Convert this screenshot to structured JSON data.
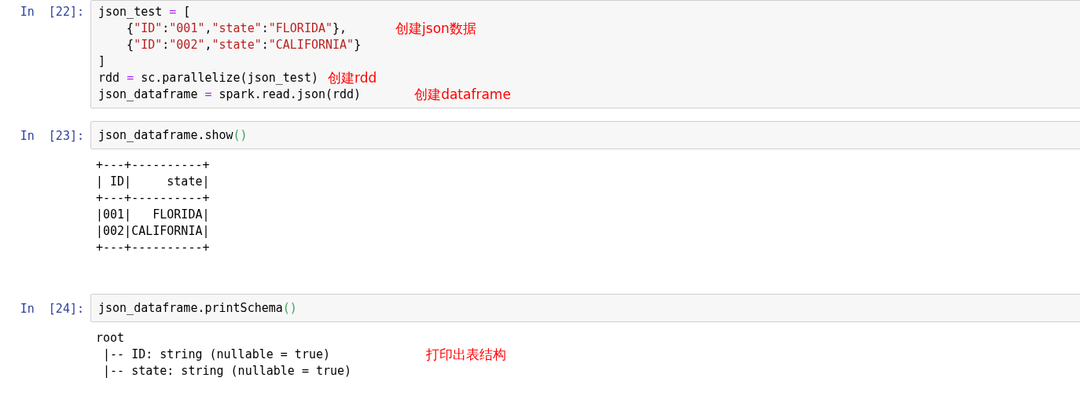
{
  "cells": [
    {
      "prompt": "In  [22]:",
      "code": [
        {
          "text": "json_test = ["
        },
        {
          "text": "    {\"ID\":\"001\",\"state\":\"FLORIDA\"},",
          "note": "创建json数据"
        },
        {
          "text": "    {\"ID\":\"002\",\"state\":\"CALIFORNIA\"}"
        },
        {
          "text": "]"
        },
        {
          "text": "rdd = sc.parallelize(json_test)",
          "note": "创建rdd"
        },
        {
          "text": "json_dataframe = spark.read.json(rdd)",
          "note": "创建dataframe"
        }
      ]
    },
    {
      "prompt": "In  [23]:",
      "code": [
        {
          "text": "json_dataframe.show()"
        }
      ],
      "output": [
        {
          "text": "+---+----------+"
        },
        {
          "text": "| ID|     state|"
        },
        {
          "text": "+---+----------+"
        },
        {
          "text": "|001|   FLORIDA|"
        },
        {
          "text": "|002|CALIFORNIA|"
        },
        {
          "text": "+---+----------+"
        }
      ]
    },
    {
      "prompt": "In  [24]:",
      "code": [
        {
          "text": "json_dataframe.printSchema()"
        }
      ],
      "output": [
        {
          "text": "root"
        },
        {
          "text": " |-- ID: string (nullable = true)",
          "note": "打印出表结构"
        },
        {
          "text": " |-- state: string (nullable = true)"
        }
      ]
    }
  ]
}
